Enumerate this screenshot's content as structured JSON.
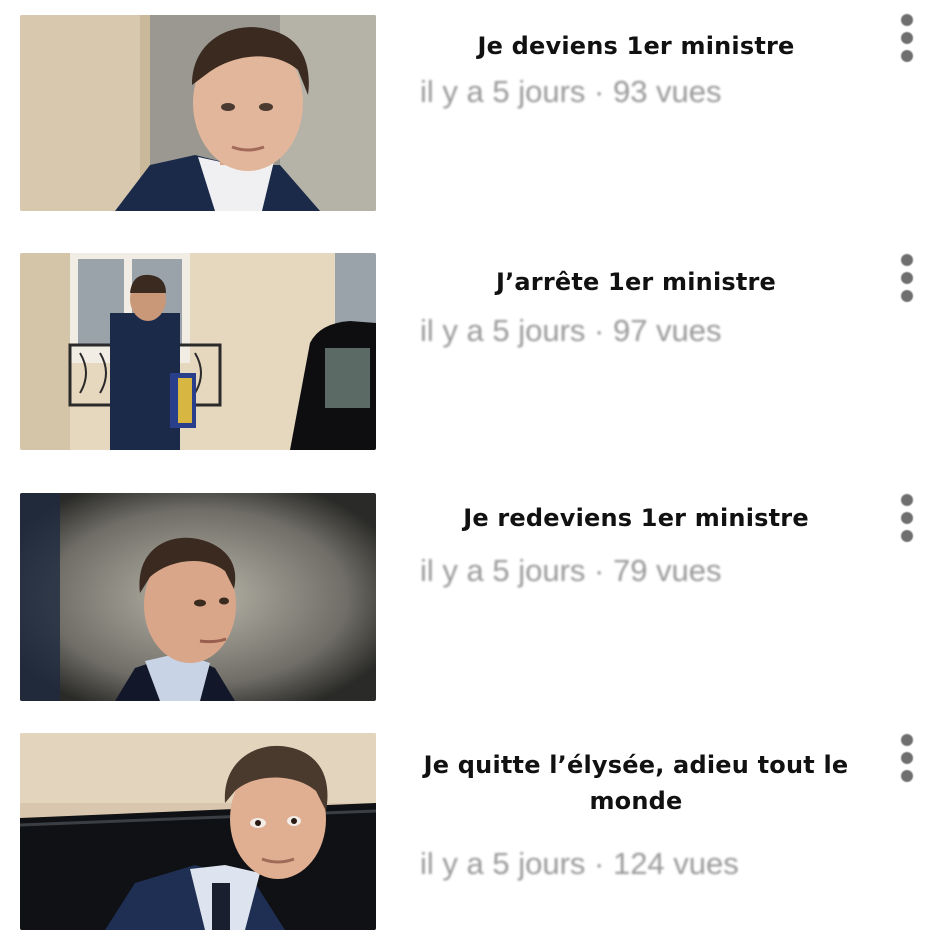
{
  "videos": [
    {
      "title": "Je deviens 1er ministre",
      "meta": "il y a 5 jours · 93 vues",
      "thumbnail_icon": "portrait-close-up-icon"
    },
    {
      "title": "J’arrête 1er ministre",
      "meta": "il y a 5 jours · 97 vues",
      "thumbnail_icon": "man-walking-to-car-icon"
    },
    {
      "title": "Je redeviens 1er ministre",
      "meta": "il y a 5 jours · 79 vues",
      "thumbnail_icon": "portrait-side-glance-icon"
    },
    {
      "title": "Je quitte l’élysée, adieu tout le monde",
      "meta": "il y a 5 jours · 124 vues",
      "thumbnail_icon": "portrait-leaving-car-icon"
    }
  ],
  "menu_icon": "more-vertical-icon",
  "colors": {
    "title_text": "#111111",
    "meta_text": "#9a9a9a",
    "menu_dots": "#6f6f6f",
    "suit_navy": "#1c2a4a"
  }
}
